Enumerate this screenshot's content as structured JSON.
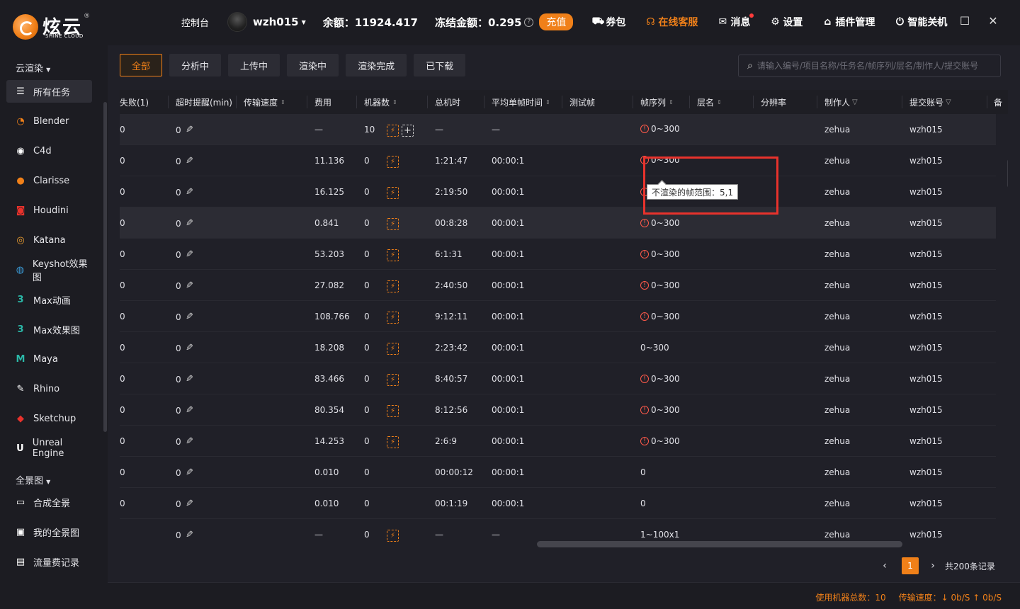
{
  "brand": {
    "name": "炫云",
    "sub": "SHINE CLOUD",
    "reg": "®"
  },
  "topbar": {
    "console": "控制台",
    "username": "wzh015",
    "balance": "余额：11924.417",
    "frozen": "冻结金额：0.295",
    "recharge": "充值",
    "nav": [
      {
        "label": "券包",
        "icon": "coupon-icon"
      },
      {
        "label": "在线客服",
        "icon": "headset-icon",
        "active": true
      },
      {
        "label": "消息",
        "icon": "mail-icon"
      },
      {
        "label": "设置",
        "icon": "gear-icon"
      },
      {
        "label": "插件管理",
        "icon": "plugin-icon"
      },
      {
        "label": "智能关机",
        "icon": "power-icon"
      }
    ]
  },
  "sidebar": {
    "section1": "云渲染",
    "items": [
      {
        "label": "所有任务",
        "icon": "list-icon",
        "active": true
      },
      {
        "label": "Blender",
        "icon": "blender-icon",
        "color": "#f08019"
      },
      {
        "label": "C4d",
        "icon": "c4d-icon",
        "color": "#ffffff"
      },
      {
        "label": "Clarisse",
        "icon": "clarisse-icon",
        "color": "#f08019"
      },
      {
        "label": "Houdini",
        "icon": "houdini-icon",
        "color": "#e8322c"
      },
      {
        "label": "Katana",
        "icon": "katana-icon",
        "color": "#f0a030"
      },
      {
        "label": "Keyshot效果图",
        "icon": "keyshot-icon",
        "color": "#3a9bd8"
      },
      {
        "label": "Max动画",
        "icon": "max-icon",
        "color": "#2bb8a8"
      },
      {
        "label": "Max效果图",
        "icon": "max-icon",
        "color": "#2bb8a8"
      },
      {
        "label": "Maya",
        "icon": "maya-icon",
        "color": "#2bb8a8"
      },
      {
        "label": "Rhino",
        "icon": "rhino-icon",
        "color": "#ffffff"
      },
      {
        "label": "Sketchup",
        "icon": "sketchup-icon",
        "color": "#e8322c"
      },
      {
        "label": "Unreal Engine",
        "icon": "unreal-icon",
        "color": "#ffffff"
      }
    ],
    "section2": "全景图",
    "items2": [
      {
        "label": "合成全景",
        "icon": "panorama-icon"
      },
      {
        "label": "我的全景图",
        "icon": "image-icon"
      },
      {
        "label": "流量费记录",
        "icon": "record-icon"
      }
    ]
  },
  "filters": [
    "全部",
    "分析中",
    "上传中",
    "渲染中",
    "渲染完成",
    "已下载"
  ],
  "search": {
    "placeholder": "请输入编号/项目名称/任务名/帧序列/层名/制作人/提交账号"
  },
  "columns": [
    "失败(1)",
    "超时提醒(min)",
    "传输速度",
    "费用",
    "机器数",
    "总机时",
    "平均单帧时间",
    "测试帧",
    "帧序列",
    "层名",
    "分辨率",
    "制作人",
    "提交账号",
    "备"
  ],
  "rows": [
    {
      "fail": "0",
      "timeout": "0",
      "cost": "—",
      "machines": "10",
      "total": "—",
      "avg": "—",
      "frames": "0~300",
      "warn": true,
      "maker": "zehua",
      "account": "wzh015",
      "dl": true,
      "add": true
    },
    {
      "fail": "0",
      "timeout": "0",
      "cost": "11.136",
      "machines": "0",
      "total": "1:21:47",
      "avg": "00:00:1",
      "frames": "0~300",
      "warn": true,
      "maker": "zehua",
      "account": "wzh015",
      "dl": true
    },
    {
      "fail": "0",
      "timeout": "0",
      "cost": "16.125",
      "machines": "0",
      "total": "2:19:50",
      "avg": "00:00:1",
      "frames": "0~300",
      "warn": true,
      "maker": "zehua",
      "account": "wzh015",
      "dl": true
    },
    {
      "fail": "0",
      "timeout": "0",
      "cost": "0.841",
      "machines": "0",
      "total": "00:8:28",
      "avg": "00:00:1",
      "frames": "0~300",
      "warn": true,
      "maker": "zehua",
      "account": "wzh015",
      "dl": true
    },
    {
      "fail": "0",
      "timeout": "0",
      "cost": "53.203",
      "machines": "0",
      "total": "6:1:31",
      "avg": "00:00:1",
      "frames": "0~300",
      "warn": true,
      "maker": "zehua",
      "account": "wzh015",
      "dl": true
    },
    {
      "fail": "0",
      "timeout": "0",
      "cost": "27.082",
      "machines": "0",
      "total": "2:40:50",
      "avg": "00:00:1",
      "frames": "0~300",
      "warn": true,
      "maker": "zehua",
      "account": "wzh015",
      "dl": true
    },
    {
      "fail": "0",
      "timeout": "0",
      "cost": "108.766",
      "machines": "0",
      "total": "9:12:11",
      "avg": "00:00:1",
      "frames": "0~300",
      "warn": true,
      "maker": "zehua",
      "account": "wzh015",
      "dl": true
    },
    {
      "fail": "0",
      "timeout": "0",
      "cost": "18.208",
      "machines": "0",
      "total": "2:23:42",
      "avg": "00:00:1",
      "frames": "0~300",
      "warn": false,
      "maker": "zehua",
      "account": "wzh015",
      "dl": true
    },
    {
      "fail": "0",
      "timeout": "0",
      "cost": "83.466",
      "machines": "0",
      "total": "8:40:57",
      "avg": "00:00:1",
      "frames": "0~300",
      "warn": true,
      "maker": "zehua",
      "account": "wzh015",
      "dl": true
    },
    {
      "fail": "0",
      "timeout": "0",
      "cost": "80.354",
      "machines": "0",
      "total": "8:12:56",
      "avg": "00:00:1",
      "frames": "0~300",
      "warn": true,
      "maker": "zehua",
      "account": "wzh015",
      "dl": true
    },
    {
      "fail": "0",
      "timeout": "0",
      "cost": "14.253",
      "machines": "0",
      "total": "2:6:9",
      "avg": "00:00:1",
      "frames": "0~300",
      "warn": true,
      "maker": "zehua",
      "account": "wzh015",
      "dl": true
    },
    {
      "fail": "0",
      "timeout": "0",
      "cost": "0.010",
      "machines": "0",
      "total": "00:00:12",
      "avg": "00:00:1",
      "frames": "0",
      "warn": false,
      "maker": "zehua",
      "account": "wzh015",
      "dl": false
    },
    {
      "fail": "0",
      "timeout": "0",
      "cost": "0.010",
      "machines": "0",
      "total": "00:1:19",
      "avg": "00:00:1",
      "frames": "0",
      "warn": false,
      "maker": "zehua",
      "account": "wzh015",
      "dl": false
    },
    {
      "fail": "",
      "timeout": "0",
      "cost": "—",
      "machines": "0",
      "total": "—",
      "avg": "—",
      "frames": "1~100x1",
      "warn": false,
      "maker": "zehua",
      "account": "wzh015",
      "dl": true
    }
  ],
  "tooltip": "不渲染的帧范围：5,1",
  "pager": {
    "current": "1",
    "total": "共200条记录"
  },
  "status": {
    "machines": "使用机器总数：10",
    "speed": "传输速度：↓ 0b/S ↑ 0b/S"
  },
  "colors": {
    "accent": "#f08019",
    "warning": "#ff5a4a",
    "highlight_box": "#e8322c"
  }
}
